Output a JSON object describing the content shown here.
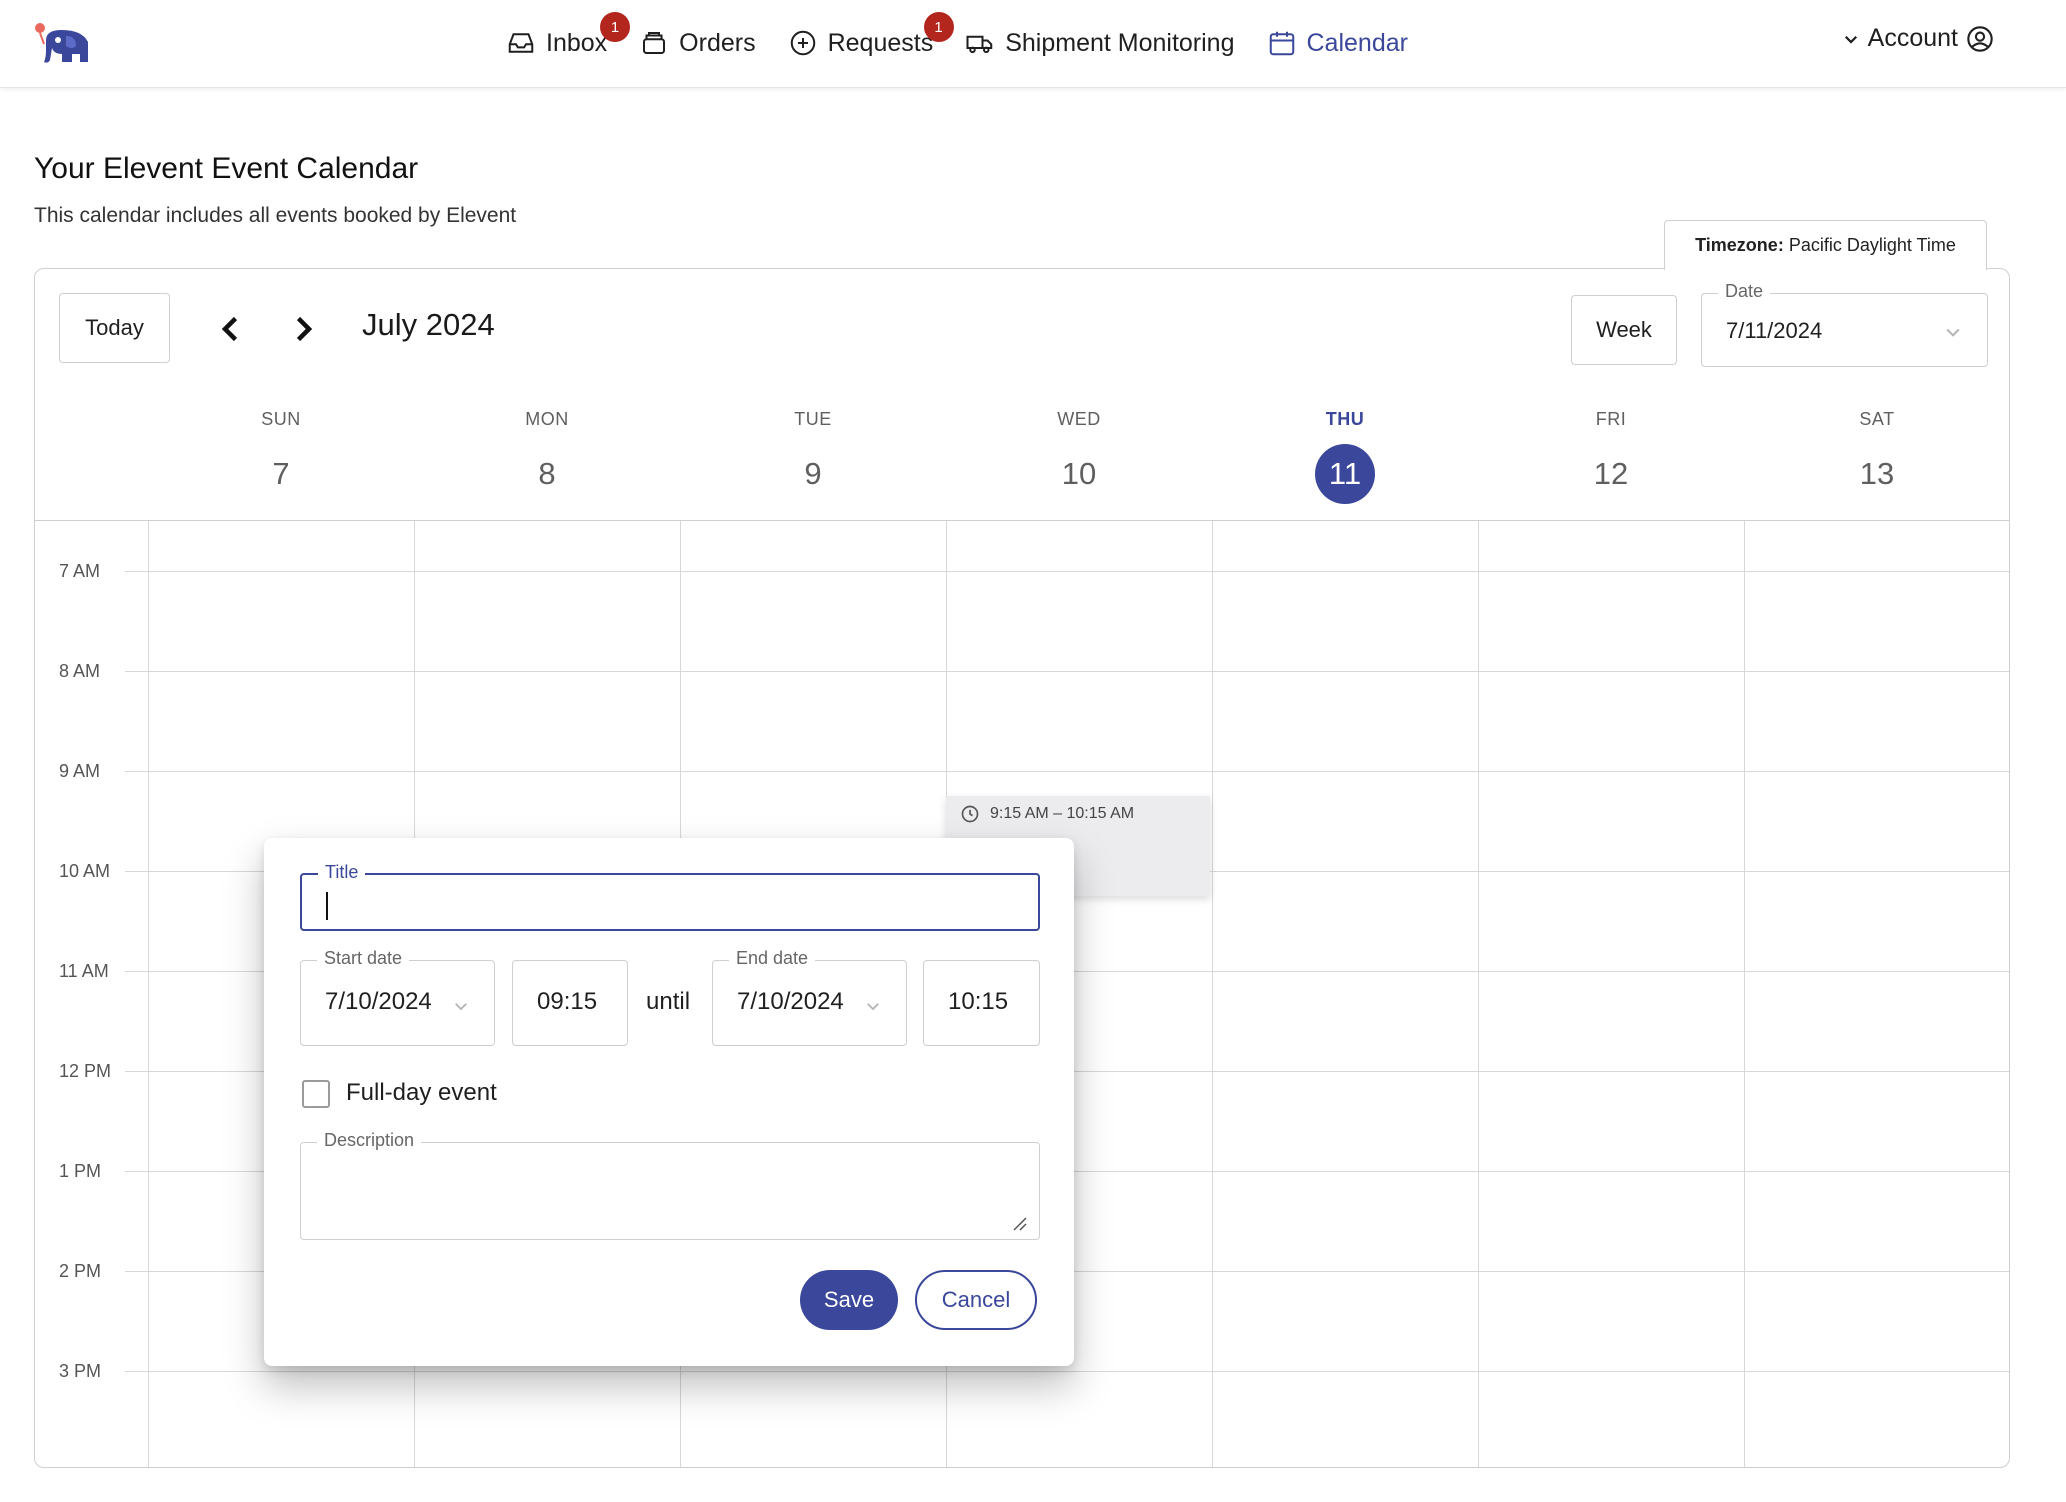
{
  "nav": {
    "items": [
      {
        "label": "Inbox",
        "icon": "inbox-icon",
        "badge": "1"
      },
      {
        "label": "Orders",
        "icon": "orders-icon"
      },
      {
        "label": "Requests",
        "icon": "plus-circle-icon",
        "badge": "1"
      },
      {
        "label": "Shipment Monitoring",
        "icon": "truck-icon"
      },
      {
        "label": "Calendar",
        "icon": "calendar-icon",
        "active": true
      }
    ],
    "account_label": "Account"
  },
  "colors": {
    "accent": "#3a479b",
    "badge": "#b3261e"
  },
  "header": {
    "title": "Your Elevent Event Calendar",
    "subtitle": "This calendar includes all events booked by Elevent",
    "timezone_label": "Timezone:",
    "timezone_value": "Pacific Daylight Time"
  },
  "toolbar": {
    "today_label": "Today",
    "month_label": "July 2024",
    "view_label": "Week",
    "date_legend": "Date",
    "date_value": "7/11/2024"
  },
  "days": [
    {
      "dow": "SUN",
      "num": "7"
    },
    {
      "dow": "MON",
      "num": "8"
    },
    {
      "dow": "TUE",
      "num": "9"
    },
    {
      "dow": "WED",
      "num": "10"
    },
    {
      "dow": "THU",
      "num": "11"
    },
    {
      "dow": "FRI",
      "num": "12"
    },
    {
      "dow": "SAT",
      "num": "13"
    }
  ],
  "hours": [
    "7 AM",
    "8 AM",
    "9 AM",
    "10 AM",
    "11 AM",
    "12 PM",
    "1 PM",
    "2 PM",
    "3 PM"
  ],
  "event": {
    "time_range": "9:15 AM – 10:15 AM"
  },
  "dialog": {
    "title_legend": "Title",
    "title_value": "",
    "start_date_legend": "Start date",
    "start_date": "7/10/2024",
    "start_time": "09:15",
    "until_label": "until",
    "end_date_legend": "End date",
    "end_date": "7/10/2024",
    "end_time": "10:15",
    "full_day_label": "Full-day event",
    "description_legend": "Description",
    "save_label": "Save",
    "cancel_label": "Cancel"
  }
}
